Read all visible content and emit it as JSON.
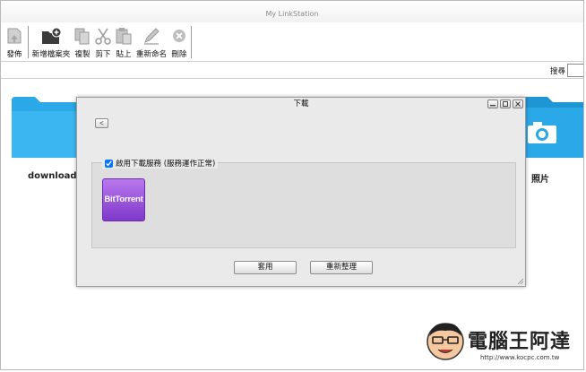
{
  "window": {
    "title": "My LinkStation"
  },
  "toolbar": {
    "publish": "發佈",
    "new_folder": "新增檔案夾",
    "copy": "複製",
    "cut": "剪下",
    "paste": "貼上",
    "rename": "重新命名",
    "delete": "刪除"
  },
  "search": {
    "label": "搜尋",
    "value": ""
  },
  "folders": [
    {
      "label": "downloads",
      "icon": "folder-icon",
      "color": "#2aa8e8"
    },
    {
      "label": "照片",
      "icon": "camera-icon",
      "color": "#2aa8e8"
    }
  ],
  "dialog": {
    "title": "下載",
    "back_label": "<",
    "enable_label": "啟用下載服務 (服務運作正常)",
    "enable_checked": true,
    "service_tile": "BitTorrent",
    "apply_button": "套用",
    "reset_button": "重新整理"
  },
  "watermark": {
    "text": "電腦王阿達",
    "url": "http://www.kocpc.com.tw"
  },
  "colors": {
    "accent_blue": "#2aa8e8",
    "bittorrent_purple": "#9b55dd",
    "dialog_bg": "#eaeaea",
    "panel_bg": "#dedede"
  }
}
